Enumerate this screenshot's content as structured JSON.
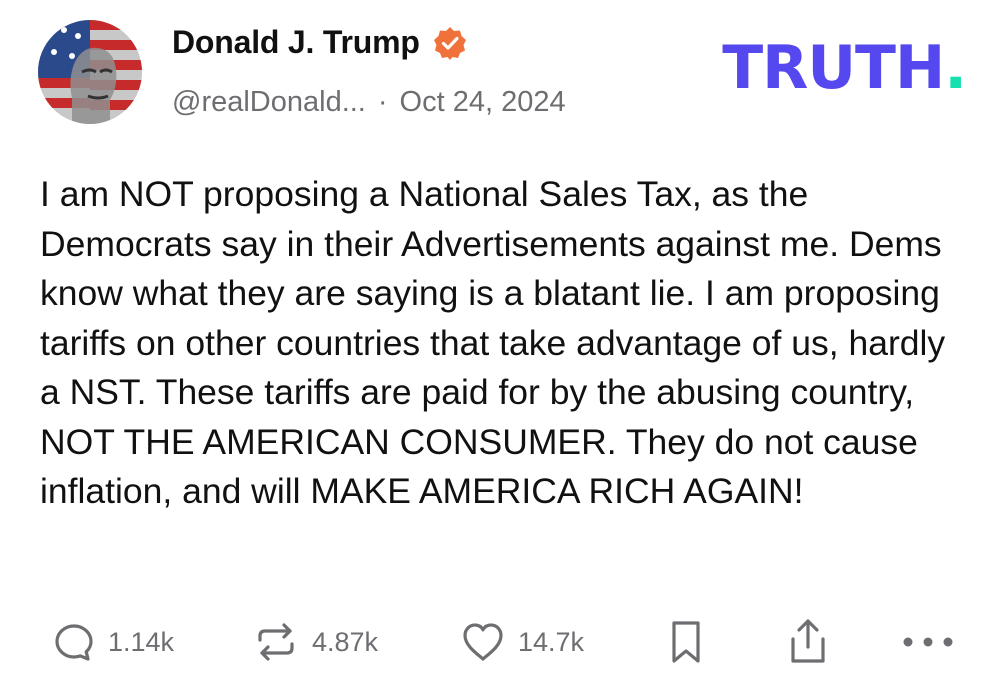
{
  "author": {
    "display_name": "Donald J. Trump",
    "handle": "@realDonald...",
    "verified_icon": "verified-badge-icon"
  },
  "meta": {
    "separator": "·",
    "date": "Oct 24, 2024"
  },
  "brand": {
    "word": "TRUTH",
    "dot": ".",
    "colors": {
      "word": "#5448ee",
      "dot": "#17e0b0"
    }
  },
  "post": {
    "text": "I am NOT proposing a National Sales Tax, as the Democrats say in their Advertisements against me. Dems know what they are saying is a blatant lie. I am proposing tariffs on other countries that take advantage of us, hardly a NST. These tariffs are paid for by the abusing country, NOT THE AMERICAN CONSUMER. They do not cause inflation, and will MAKE AMERICA RICH AGAIN!"
  },
  "actions": {
    "replies": {
      "icon": "reply-icon",
      "count": "1.14k"
    },
    "retruths": {
      "icon": "retruth-icon",
      "count": "4.87k"
    },
    "likes": {
      "icon": "heart-icon",
      "count": "14.7k"
    },
    "bookmark": {
      "icon": "bookmark-icon"
    },
    "share": {
      "icon": "share-icon"
    },
    "more": {
      "icon": "more-icon"
    }
  },
  "colors": {
    "text": "#111111",
    "muted": "#6e6e72",
    "verified_badge": "#f0713a"
  }
}
